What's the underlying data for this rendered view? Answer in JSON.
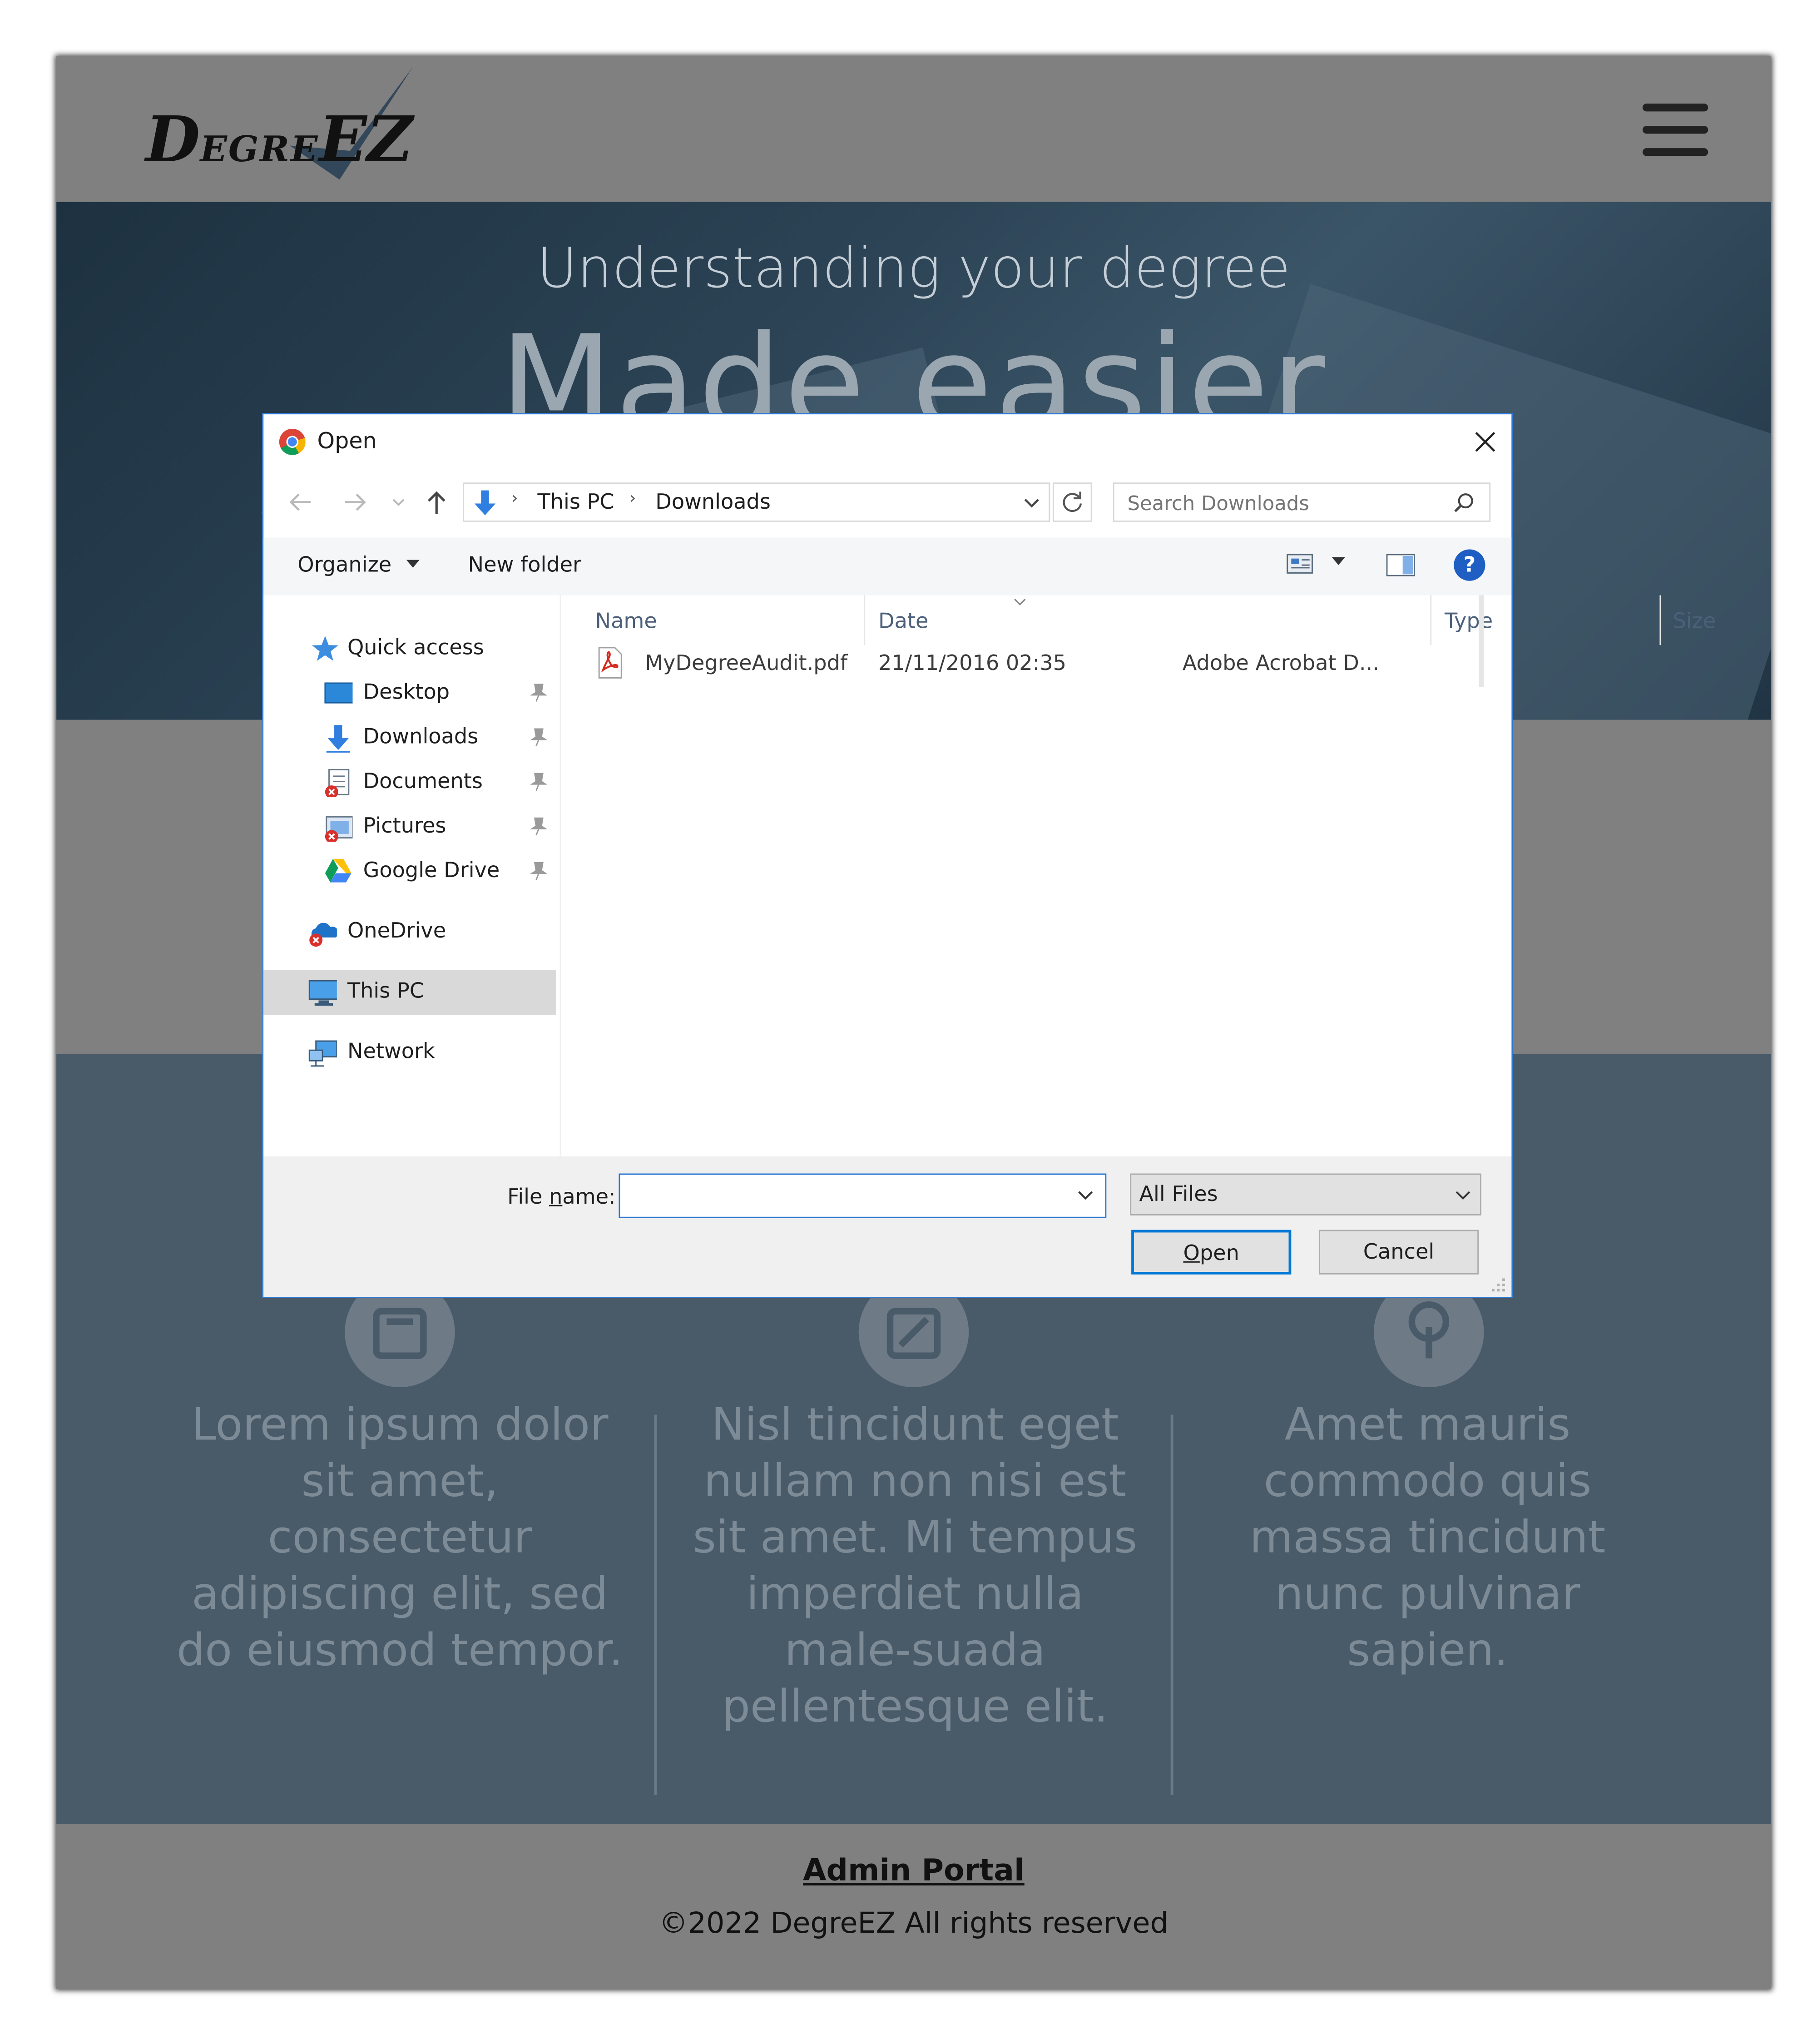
{
  "site": {
    "logo_big_d": "D",
    "logo_egre": "EGRE",
    "logo_ez": "EZ",
    "hero_subtitle": "Understanding your degree",
    "hero_title": "Made easier",
    "features": [
      {
        "icon": "book-icon",
        "text": "Lorem ipsum dolor sit amet, consectetur adipiscing elit, sed do eiusmod tempor."
      },
      {
        "icon": "chart-icon",
        "text": "Nisl tincidunt eget nullam non nisi est sit amet. Mi tempus imperdiet nulla male-suada pellentesque elit."
      },
      {
        "icon": "tree-icon",
        "text": "Amet mauris commodo quis  massa tincidunt nunc pulvinar sapien."
      }
    ],
    "footer": {
      "admin_link": "Admin Portal",
      "copyright": "©2022 DegreEZ All rights reserved"
    }
  },
  "dialog": {
    "title": "Open",
    "breadcrumb": [
      "This PC",
      "Downloads"
    ],
    "search_placeholder": "Search Downloads",
    "toolbar": {
      "organize": "Organize",
      "new_folder": "New folder"
    },
    "nav": {
      "quick_access": "Quick access",
      "quick_items": [
        "Desktop",
        "Downloads",
        "Documents",
        "Pictures",
        "Google Drive"
      ],
      "onedrive": "OneDrive",
      "this_pc": "This PC",
      "network": "Network"
    },
    "columns": [
      "Name",
      "Date",
      "Type",
      "Size"
    ],
    "files": [
      {
        "name": "MyDegreeAudit.pdf",
        "date": "21/11/2016 02:35",
        "type": "Adobe Acrobat D..."
      }
    ],
    "file_name_label_pre": "File ",
    "file_name_label_u": "n",
    "file_name_label_post": "ame:",
    "file_name_value": "",
    "filter": "All Files",
    "open_u": "O",
    "open_rest": "pen",
    "cancel": "Cancel"
  },
  "colors": {
    "accent": "#2b78d4",
    "site_gray": "#808080",
    "hero_navy": "#2c4456",
    "features_bg": "#495a69",
    "help_blue": "#1f5fc4"
  }
}
